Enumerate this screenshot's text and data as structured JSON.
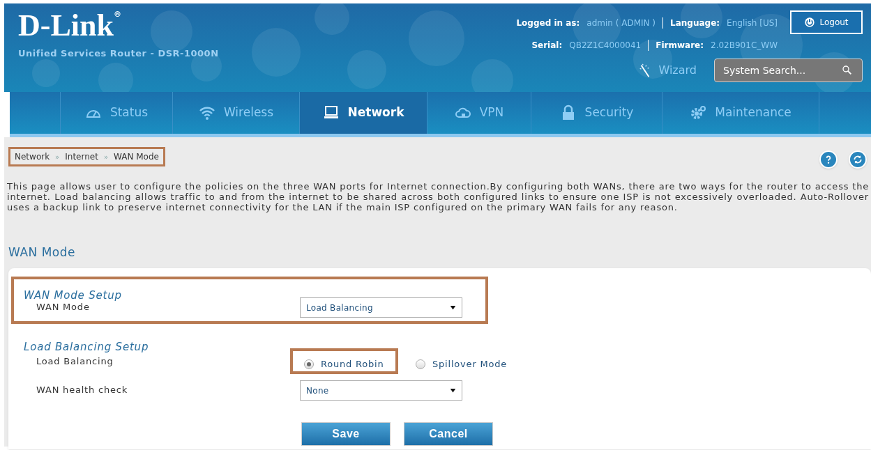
{
  "header": {
    "logo": "D-Link",
    "logo_mark": "®",
    "product": "Unified Services Router - DSR-1000N",
    "info": [
      {
        "label": "Logged in as:",
        "value": "admin ( ADMIN )"
      },
      {
        "label": "Language:",
        "value": "English [US]"
      }
    ],
    "info2": [
      {
        "label": "Serial:",
        "value": "QB2Z1C4000041"
      },
      {
        "label": "Firmware:",
        "value": "2.02B901C_WW"
      }
    ],
    "logout": "Logout",
    "wizard": "Wizard",
    "search": {
      "placeholder": "System Search..."
    }
  },
  "nav": [
    {
      "label": "Status",
      "selected": false
    },
    {
      "label": "Wireless",
      "selected": false
    },
    {
      "label": "Network",
      "selected": true
    },
    {
      "label": "VPN",
      "selected": false
    },
    {
      "label": "Security",
      "selected": false
    },
    {
      "label": "Maintenance",
      "selected": false
    }
  ],
  "breadcrumb": {
    "items": [
      "Network",
      "Internet",
      "WAN Mode"
    ],
    "separator": "»",
    "highlighted": true
  },
  "description": "This page allows user to configure the policies on the three WAN ports for Internet connection.By configuring both WANs, there are two ways for the router to access the internet. Load balancing allows traffic to and from the internet to be shared across both configured links to ensure one ISP is not excessively overloaded. Auto-Rollover uses a backup link to preserve internet connectivity for the LAN if the main ISP configured on the primary WAN fails for any reason.",
  "page_title": "WAN Mode",
  "sections": [
    {
      "title": "WAN Mode Setup",
      "highlighted": true,
      "rows": [
        {
          "kind": "select",
          "label": "WAN Mode",
          "value": "Load Balancing"
        }
      ]
    },
    {
      "title": "Load Balancing Setup",
      "highlighted": false,
      "rows": [
        {
          "kind": "radio",
          "label": "Load Balancing",
          "options": [
            {
              "label": "Round Robin",
              "selected": true,
              "highlighted": true
            },
            {
              "label": "Spillover Mode",
              "selected": false,
              "highlighted": false
            }
          ]
        },
        {
          "kind": "select",
          "label": "WAN health check",
          "value": "None"
        }
      ]
    }
  ],
  "buttons": [
    "Save",
    "Cancel"
  ]
}
